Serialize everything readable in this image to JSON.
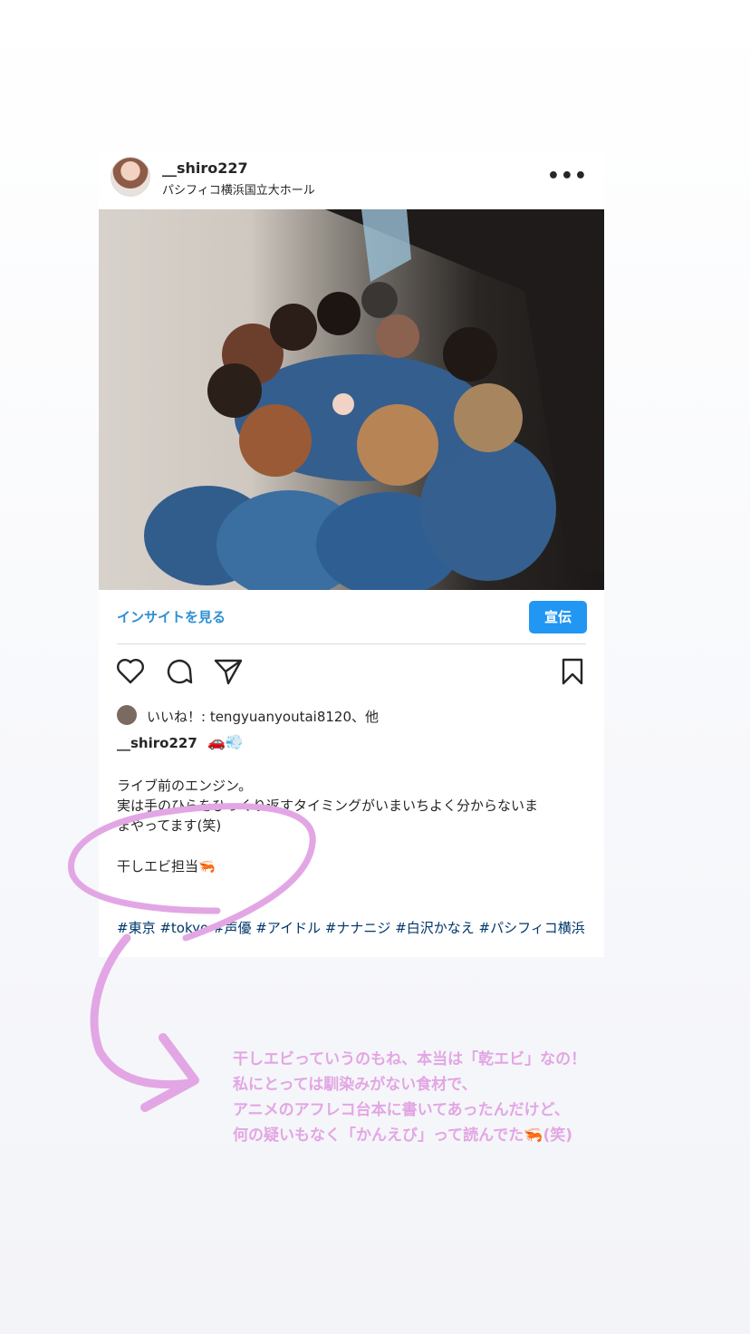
{
  "post": {
    "username": "__shiro227",
    "location": "パシフィコ横浜国立大ホール",
    "more_icon": "more-horizontal-icon",
    "insights_label": "インサイトを見る",
    "promote_label": "宣伝",
    "likes_text": "いいね！: tengyuanyoutai8120、他",
    "caption_user": "__shiro227",
    "caption_emoji": "🚗💨",
    "caption_lines": [
      "ライブ前のエンジン。",
      "実は手のひらをひっくり返すタイミングがいまいちよく分からないま",
      "まやってます(笑)"
    ],
    "shrimp_line": "干しエビ担当🦐",
    "hashtags": "#東京 #tokyo #声優 #アイドル #ナナニジ #白沢かなえ #パシフィコ横浜"
  },
  "story_note": {
    "lines": [
      "干しエビっていうのもね、本当は「乾エビ」なの！",
      "私にとっては馴染みがない食材で、",
      "アニメのアフレコ台本に書いてあったんだけど、",
      "何の疑いもなく「かんえび」って読んでた🦐(笑)"
    ]
  },
  "colors": {
    "link": "#2d8fd5",
    "promote_bg": "#2196f3",
    "hashtag": "#00376b",
    "doodle": "#e3a6e4"
  }
}
